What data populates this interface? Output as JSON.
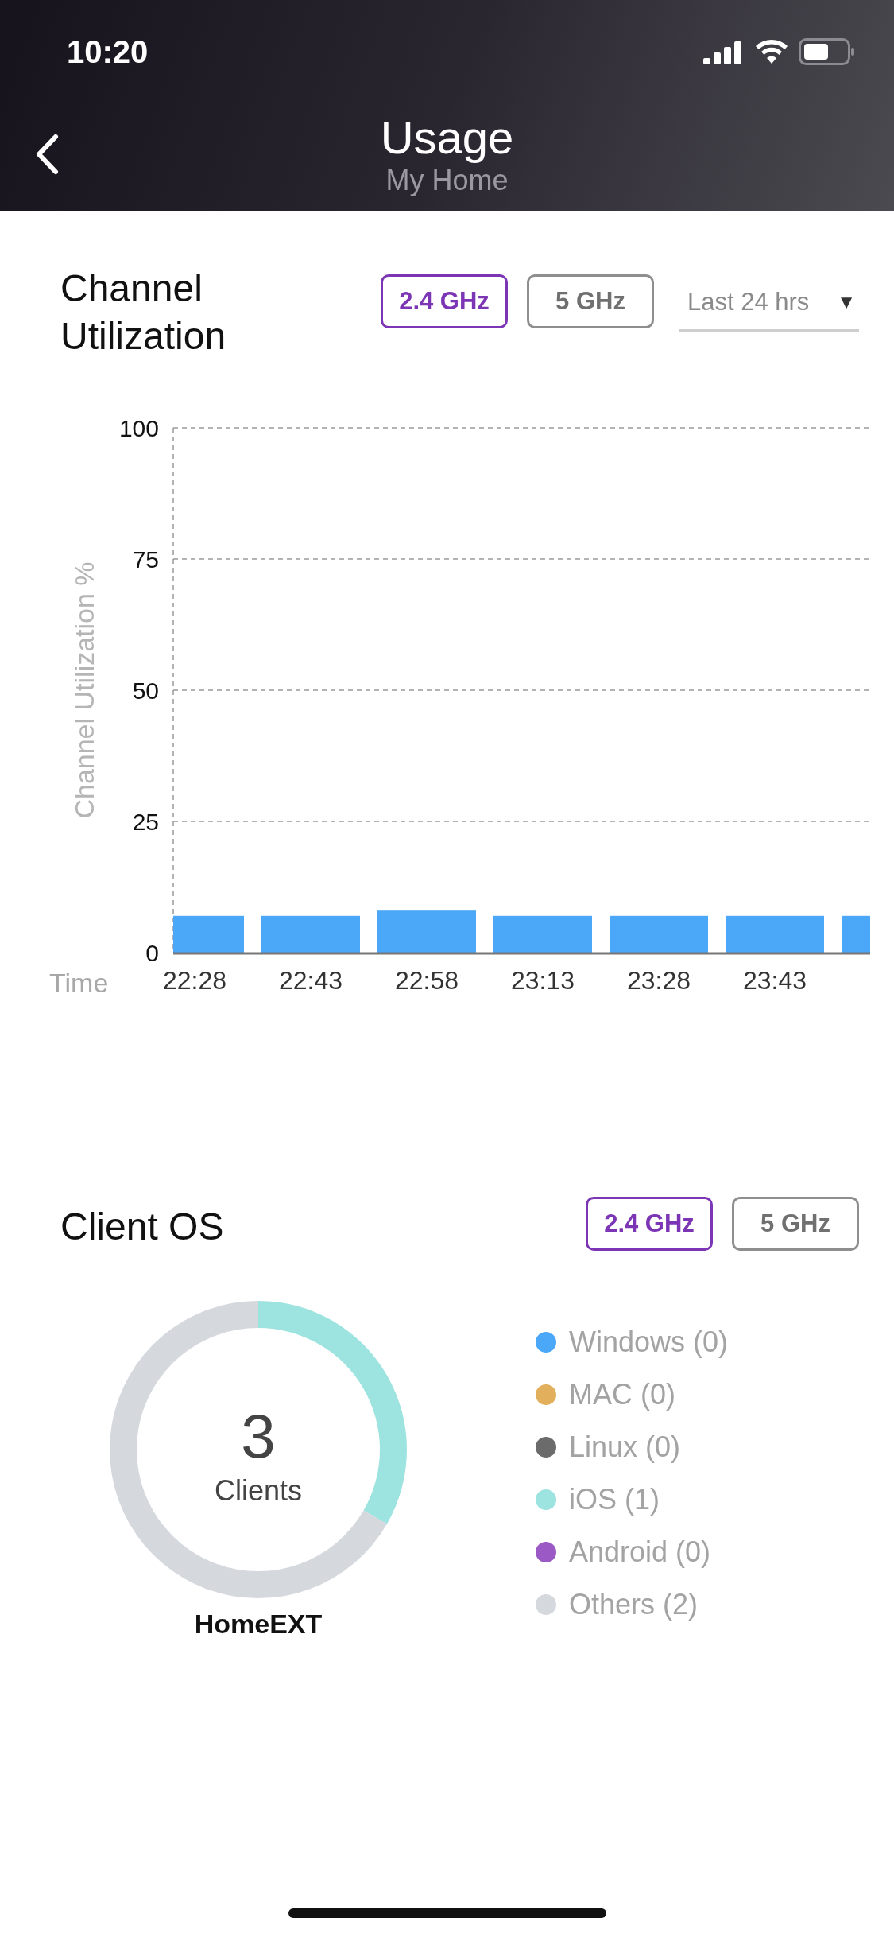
{
  "status_bar": {
    "time": "10:20"
  },
  "header": {
    "title": "Usage",
    "subtitle": "My Home"
  },
  "channel_utilization": {
    "title": "Channel Utilization",
    "bands": [
      {
        "label": "2.4 GHz",
        "selected": true
      },
      {
        "label": "5 GHz",
        "selected": false
      }
    ],
    "range": {
      "label": "Last 24 hrs",
      "arrow": "▼"
    },
    "chart_data": {
      "type": "bar",
      "grid": true,
      "xlabel": "Time",
      "ylabel": "Channel Utilization %",
      "categories": [
        "22:28",
        "22:43",
        "22:58",
        "23:13",
        "23:28",
        "23:43",
        null
      ],
      "series": [
        {
          "color": "#4ba7f7",
          "values": [
            7,
            7,
            8,
            7,
            7,
            7,
            7
          ]
        }
      ],
      "ylim": [
        0,
        100
      ],
      "yticks": [
        0,
        25,
        50,
        75,
        100
      ]
    }
  },
  "client_os": {
    "title": "Client OS",
    "bands": [
      {
        "label": "2.4 GHz",
        "selected": true
      },
      {
        "label": "5 GHz",
        "selected": false
      }
    ],
    "chart_data": {
      "type": "donut",
      "values": [
        0,
        0,
        0,
        33.33,
        0,
        66.67
      ]
    },
    "total": "3",
    "total_label": "Clients",
    "device": "HomeEXT",
    "legend": [
      {
        "label": "Windows (0)",
        "color": "#4ba7f7"
      },
      {
        "label": "MAC (0)",
        "color": "#e2b05c"
      },
      {
        "label": "Linux (0)",
        "color": "#6b6b6b"
      },
      {
        "label": "iOS (1)",
        "color": "#9de3e0"
      },
      {
        "label": "Android (0)",
        "color": "#9b59c6"
      },
      {
        "label": "Others (2)",
        "color": "#d5d9de"
      }
    ]
  }
}
